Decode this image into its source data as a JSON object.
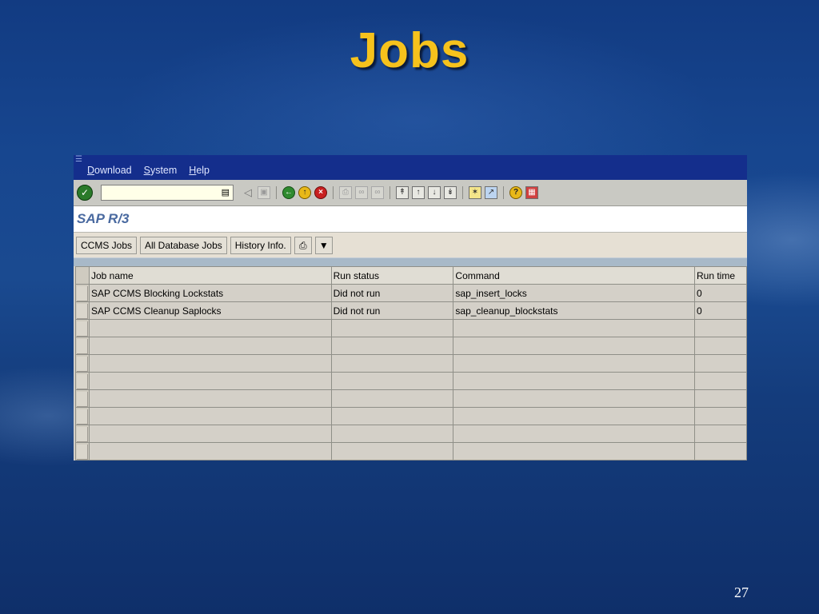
{
  "slide": {
    "title": "Jobs",
    "page_number": "27"
  },
  "menubar": {
    "items": [
      "Download",
      "System",
      "Help"
    ]
  },
  "toolbar": {
    "command_field": "",
    "icons": [
      "enter-icon",
      "command-dropdown-icon",
      "back-arrow-icon",
      "save-icon",
      "back-icon",
      "exit-icon",
      "cancel-icon",
      "print-icon",
      "find-icon",
      "find-next-icon",
      "first-page-icon",
      "previous-page-icon",
      "next-page-icon",
      "last-page-icon",
      "create-session-icon",
      "shortcut-icon",
      "help-icon",
      "layout-menu-icon"
    ]
  },
  "screen": {
    "title": "SAP R/3"
  },
  "app_toolbar": {
    "buttons": [
      "CCMS Jobs",
      "All Database Jobs",
      "History Info."
    ],
    "icons": [
      "print-icon",
      "filter-icon"
    ]
  },
  "table": {
    "columns": [
      "Job name",
      "Run status",
      "Command",
      "Run time"
    ],
    "rows": [
      [
        "SAP CCMS Blocking Lockstats",
        "Did not run",
        "sap_insert_locks",
        "0"
      ],
      [
        "SAP CCMS Cleanup Saplocks",
        "Did not run",
        "sap_cleanup_blockstats",
        "0"
      ],
      [
        "",
        "",
        "",
        ""
      ],
      [
        "",
        "",
        "",
        ""
      ],
      [
        "",
        "",
        "",
        ""
      ],
      [
        "",
        "",
        "",
        ""
      ],
      [
        "",
        "",
        "",
        ""
      ],
      [
        "",
        "",
        "",
        ""
      ],
      [
        "",
        "",
        "",
        ""
      ],
      [
        "",
        "",
        "",
        ""
      ]
    ]
  },
  "colors": {
    "title": "#f6c21c",
    "menubar": "#142e8c",
    "sap_title": "#4a6aa0"
  }
}
